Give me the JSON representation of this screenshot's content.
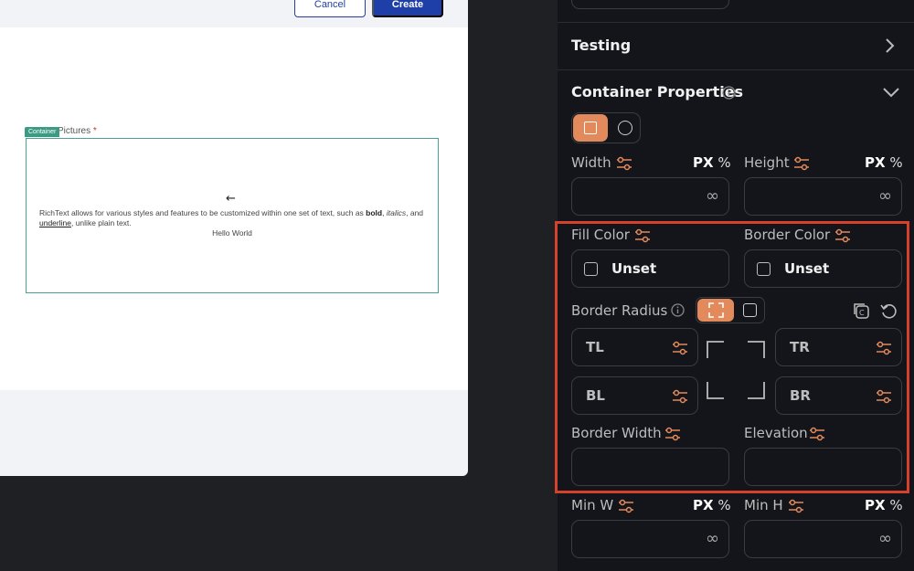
{
  "dialog": {
    "cancel_label": "Cancel",
    "create_label": "Create",
    "field_label": "Pictures",
    "required_mark": "*",
    "container_tag": "Container",
    "richtext": {
      "intro": "RichText allows for various styles and features to be customized within one set of text, such as ",
      "bold": "bold",
      "sep1": ", ",
      "italics": "italics",
      "sep2": ", and ",
      "underline": "underline",
      "outro": ", unlike plain text."
    },
    "hello": "Hello World"
  },
  "panel": {
    "testing_title": "Testing",
    "container_title": "Container Properties",
    "width_label": "Width",
    "height_label": "Height",
    "min_w_label": "Min W",
    "min_h_label": "Min H",
    "px": "PX",
    "pct": "%",
    "infinity": "∞",
    "fill_color_label": "Fill Color",
    "border_color_label": "Border Color",
    "unset": "Unset",
    "border_radius_label": "Border Radius",
    "tl": "TL",
    "tr": "TR",
    "bl": "BL",
    "br": "BR",
    "border_width_label": "Border Width",
    "elevation_label": "Elevation"
  },
  "colors": {
    "accent": "#e38a5c",
    "highlight": "#d5412a",
    "create_button": "#1f3fa8",
    "container_outline": "#4aa293"
  },
  "icons": [
    "chevron-right-icon",
    "chevron-down-icon",
    "info-icon",
    "square-shape-icon",
    "circle-shape-icon",
    "tune-icon",
    "copy-icon",
    "reset-icon",
    "arrow-left-icon"
  ]
}
